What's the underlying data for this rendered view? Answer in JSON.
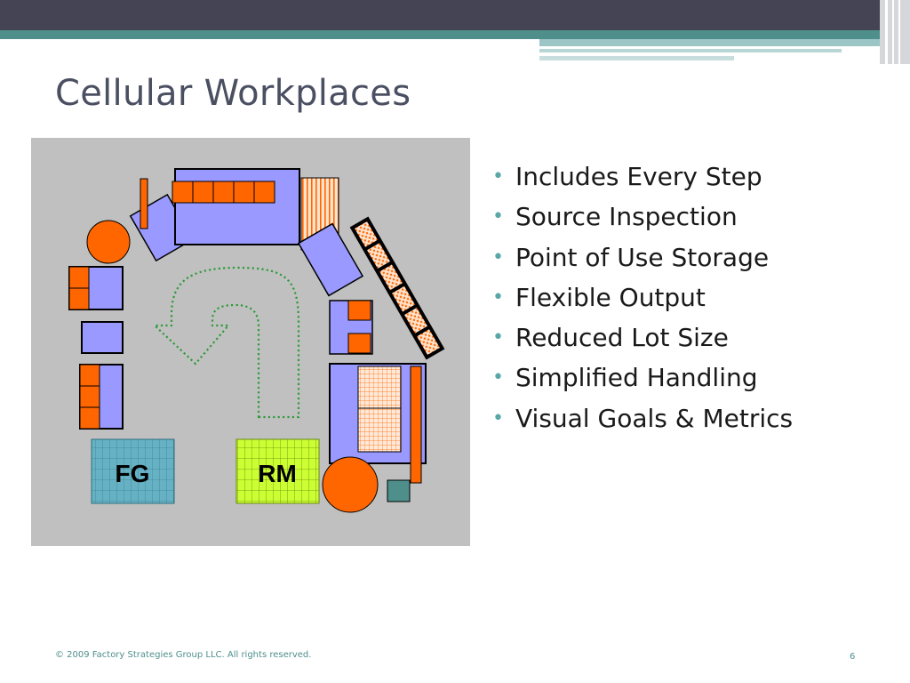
{
  "slide": {
    "title": "Cellular Workplaces",
    "bullets": [
      "Includes Every Step",
      "Source Inspection",
      "Point of Use Storage",
      "Flexible Output",
      "Reduced Lot Size",
      "Simplified Handling",
      "Visual Goals & Metrics"
    ],
    "footer": "© 2009 Factory Strategies Group LLC.  All rights reserved.",
    "page_number": "6"
  },
  "diagram": {
    "finished_goods_label": "FG",
    "raw_materials_label": "RM"
  },
  "colors": {
    "header_dark": "#444455",
    "accent_teal": "#4e8f8c",
    "machine_fill": "#9999ff",
    "buffer_orange": "#ff6600",
    "diagram_bg": "#c0c0c0",
    "flow_arrow": "#2e9a3a",
    "fg_fill": "#66b2c4",
    "rm_fill": "#ccff33"
  }
}
